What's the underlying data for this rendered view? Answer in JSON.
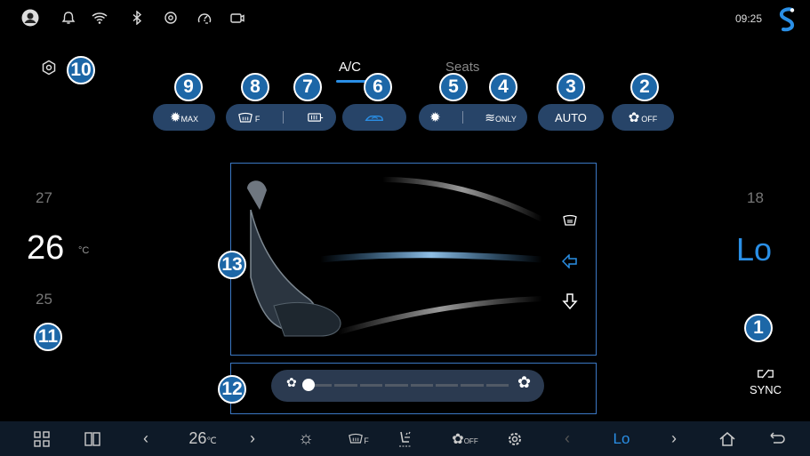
{
  "status_bar": {
    "time": "09:25",
    "icons": [
      "avatar-icon",
      "bell-icon",
      "wifi-icon",
      "bluetooth-icon",
      "location-icon",
      "speedometer-icon",
      "screen-mirror-icon",
      "brand-logo-icon"
    ]
  },
  "tabs": {
    "ac": "A/C",
    "seats": "Seats"
  },
  "controls": {
    "max_defrost": {
      "icon": "sun-defrost-icon",
      "label": "MAX"
    },
    "front_defrost": {
      "icon": "front-windshield-defrost-icon",
      "label": "F"
    },
    "rear_defrost": {
      "icon": "rear-window-defrost-icon"
    },
    "recirculation": {
      "icon": "recirculation-car-icon"
    },
    "ac_snow": {
      "icon": "ac-icon"
    },
    "vent_only": {
      "icon": "vent-icon",
      "label": "ONLY"
    },
    "auto": {
      "label": "AUTO"
    },
    "fan_off": {
      "icon": "fan-icon",
      "label": "OFF"
    }
  },
  "callouts": [
    "1",
    "2",
    "3",
    "4",
    "5",
    "6",
    "7",
    "8",
    "9",
    "10",
    "11",
    "12",
    "13"
  ],
  "left_temp": {
    "above": "27",
    "current": "26",
    "unit": "°C",
    "below": "25"
  },
  "right_temp": {
    "above": "18",
    "current": "Lo"
  },
  "sync": {
    "label": "SYNC"
  },
  "fan_speed": {
    "level": 0.0,
    "segments": 8
  },
  "airflow_icons": [
    "windshield-vent-icon",
    "face-vent-icon",
    "feet-vent-icon"
  ],
  "bottom_bar": {
    "left_temp": "26",
    "left_temp_unit": "℃",
    "right_temp": "Lo",
    "fan_off_label": "OFF",
    "defrost_label": "F"
  },
  "colors": {
    "accent": "#2a8fe6",
    "pill": "#274468",
    "badge": "#1d67a7",
    "frame": "#3b78c4"
  }
}
